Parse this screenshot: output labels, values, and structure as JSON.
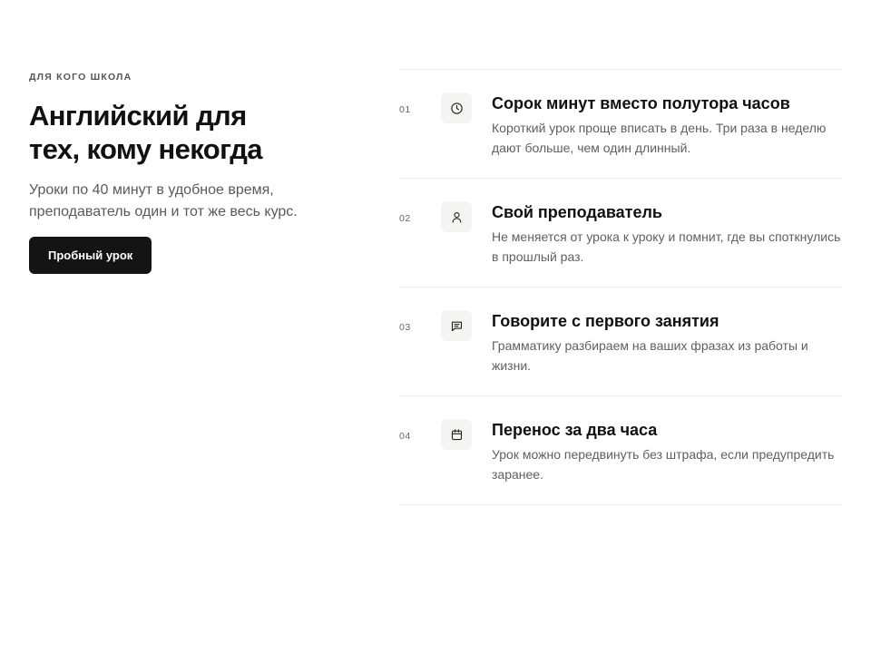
{
  "hero": {
    "eyebrow": "Для кого школа",
    "headline": "Английский для тех, кому некогда",
    "subtitle": "Уроки по 40 минут в удобное время, преподаватель один и тот же весь курс.",
    "cta_label": "Пробный урок"
  },
  "features": [
    {
      "number": "01",
      "icon": "clock-icon",
      "title": "Сорок минут вместо полутора часов",
      "description": "Короткий урок проще вписать в день. Три раза в неделю дают больше, чем один длинный."
    },
    {
      "number": "02",
      "icon": "user-icon",
      "title": "Свой преподаватель",
      "description": "Не меняется от урока к уроку и помнит, где вы споткнулись в прошлый раз."
    },
    {
      "number": "03",
      "icon": "chat-icon",
      "title": "Говорите с первого занятия",
      "description": "Грамматику разбираем на ваших фразах из работы и жизни."
    },
    {
      "number": "04",
      "icon": "calendar-icon",
      "title": "Перенос за два часа",
      "description": "Урок можно передвинуть без штрафа, если предупредить заранее."
    }
  ],
  "colors": {
    "cta_background": "#141414",
    "icon_tile_background": "#f4f4f2",
    "divider": "#ebebeb"
  }
}
